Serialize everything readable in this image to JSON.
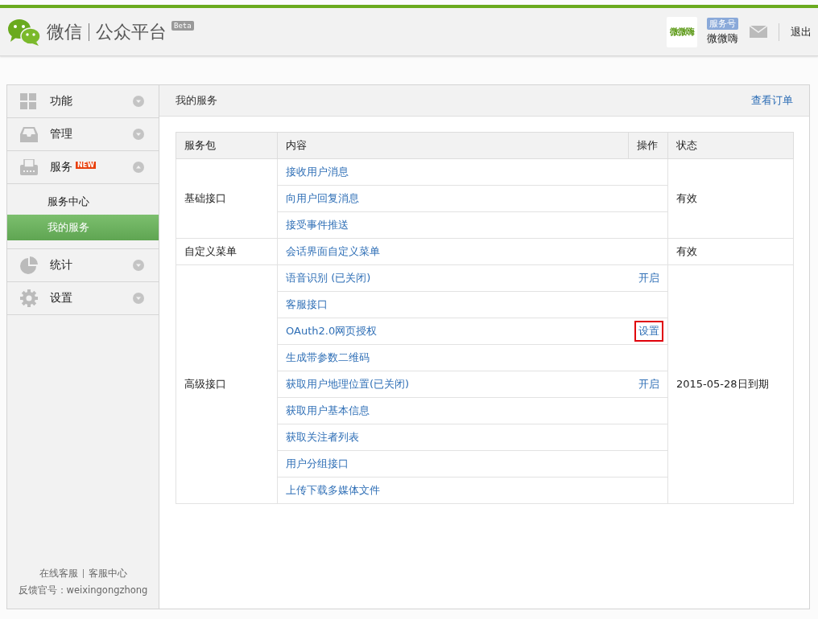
{
  "header": {
    "brand": "微信",
    "product": "公众平台",
    "beta": "Beta",
    "account": {
      "logo_text": "微微嗨",
      "type_badge": "服务号",
      "name": "微微嗨"
    },
    "logout": "退出"
  },
  "sidebar": {
    "items": [
      {
        "label": "功能",
        "expanded": false
      },
      {
        "label": "管理",
        "expanded": false
      },
      {
        "label": "服务",
        "badge": "NEW",
        "expanded": true,
        "children": [
          {
            "label": "服务中心",
            "selected": false
          },
          {
            "label": "我的服务",
            "selected": true
          }
        ]
      },
      {
        "label": "统计",
        "expanded": false
      },
      {
        "label": "设置",
        "expanded": false
      }
    ],
    "footer_links": [
      "在线客服",
      "客服中心"
    ],
    "feedback": "反馈官号：weixingongzhong"
  },
  "main": {
    "title": "我的服务",
    "orders_link": "查看订单",
    "table": {
      "columns": [
        "服务包",
        "内容",
        "操作",
        "状态"
      ],
      "groups": [
        {
          "name": "基础接口",
          "status": "有效",
          "items": [
            {
              "label": "接收用户消息"
            },
            {
              "label": "向用户回复消息"
            },
            {
              "label": "接受事件推送"
            }
          ]
        },
        {
          "name": "自定义菜单",
          "status": "有效",
          "items": [
            {
              "label": "会话界面自定义菜单"
            }
          ]
        },
        {
          "name": "高级接口",
          "status": "2015-05-28日到期",
          "items": [
            {
              "label": "语音识别 (已关闭)",
              "action": "开启"
            },
            {
              "label": "客服接口"
            },
            {
              "label": "OAuth2.0网页授权",
              "action": "设置",
              "highlighted": true
            },
            {
              "label": "生成带参数二维码"
            },
            {
              "label": "获取用户地理位置(已关闭)",
              "action": "开启"
            },
            {
              "label": "获取用户基本信息"
            },
            {
              "label": "获取关注者列表"
            },
            {
              "label": "用户分组接口"
            },
            {
              "label": "上传下载多媒体文件"
            }
          ]
        }
      ]
    }
  }
}
